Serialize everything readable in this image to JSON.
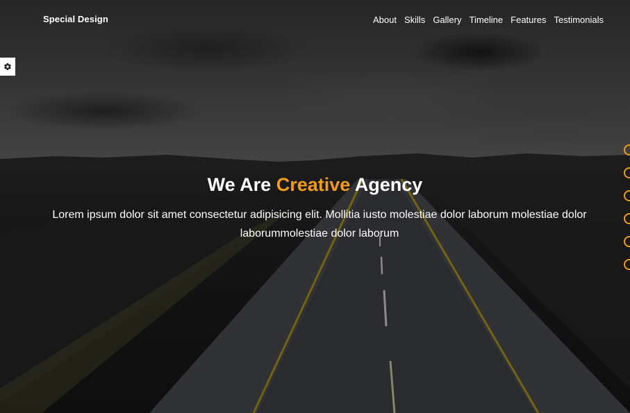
{
  "header": {
    "brand": "Special Design",
    "nav": [
      {
        "label": "About"
      },
      {
        "label": "Skills"
      },
      {
        "label": "Gallery"
      },
      {
        "label": "Timeline"
      },
      {
        "label": "Features"
      },
      {
        "label": "Testimonials"
      }
    ]
  },
  "settings": {
    "icon": "gear-icon"
  },
  "hero": {
    "title_part1": "We Are ",
    "title_accent": "Creative",
    "title_part2": " Agency",
    "text": "Lorem ipsum dolor sit amet consectetur adipisicing elit. Mollitia iusto molestiae dolor laborum molestiae dolor laborummolestiae dolor laborum"
  },
  "bullets": {
    "count": 6
  },
  "colors": {
    "accent": "#f39c12",
    "text": "#ffffff",
    "settings_bg": "#ffffff"
  }
}
